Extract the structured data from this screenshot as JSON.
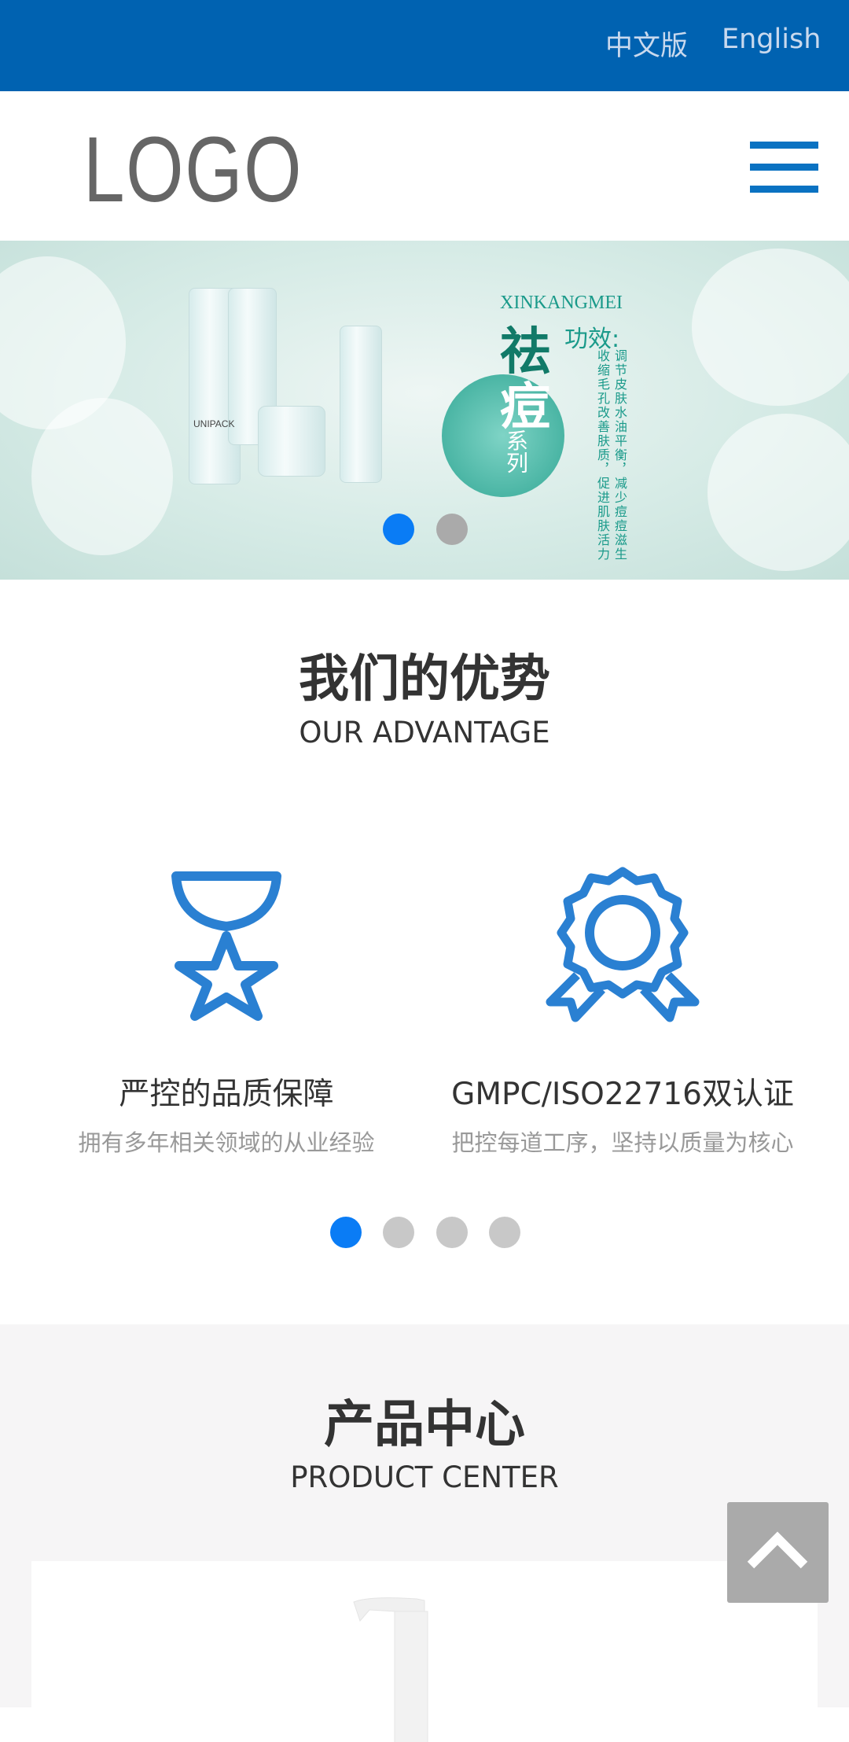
{
  "topbar": {
    "lang_cn": "中文版",
    "lang_en": "English",
    "color": "#0062b1"
  },
  "header": {
    "logo": "LOGO",
    "menu_icon": "hamburger-icon"
  },
  "banner": {
    "brand": "XINKANGMEI",
    "char1": "祛",
    "char2": "痘",
    "series": "系列",
    "effect_label": "功效:",
    "effect_line1": "调节皮肤水油平衡，减少痘痘滋生",
    "effect_line2": "收缩毛孔改善肤质，促进肌肤活力",
    "product_brand": "UNIPACK",
    "dots": {
      "count": 2,
      "active": 0
    }
  },
  "advantage": {
    "title": "我们的优势",
    "subtitle": "OUR ADVANTAGE",
    "items": [
      {
        "icon": "medal-star-icon",
        "title": "严控的品质保障",
        "desc": "拥有多年相关领域的从业经验"
      },
      {
        "icon": "award-ribbon-icon",
        "title": "GMPC/ISO22716双认证",
        "desc": "把控每道工序，坚持以质量为核心"
      }
    ],
    "dots": {
      "count": 4,
      "active": 0
    }
  },
  "products": {
    "title": "产品中心",
    "subtitle": "PRODUCT CENTER"
  },
  "back_to_top": {
    "icon": "chevron-up-icon"
  },
  "colors": {
    "accent": "#0a72c2",
    "dot_active": "#0a7cf5",
    "dot_inactive": "#c8c8c8"
  }
}
